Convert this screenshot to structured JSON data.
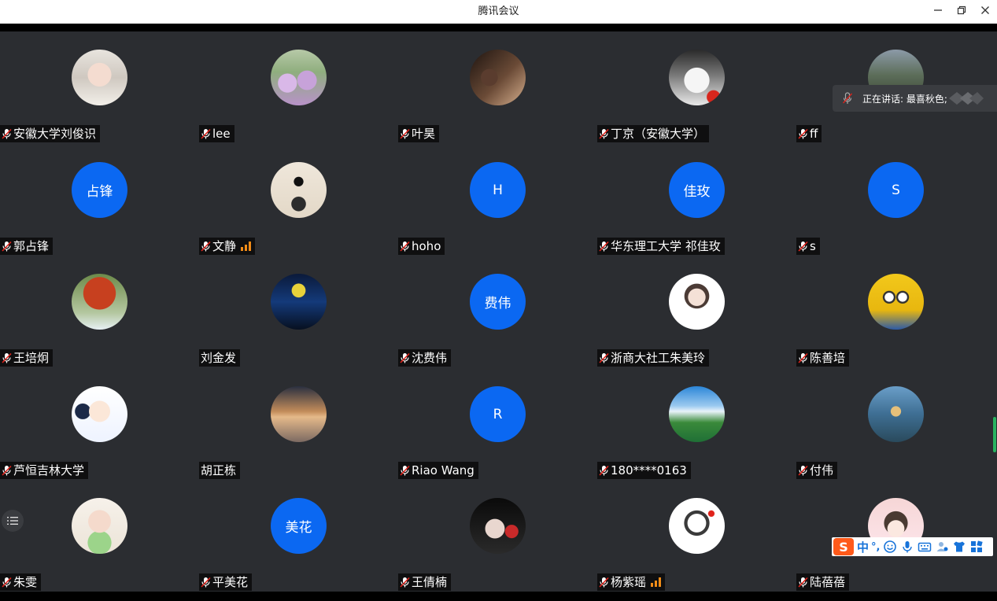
{
  "window": {
    "title": "腾讯会议",
    "minimize_icon": "minimize-icon",
    "maximize_icon": "restore-icon",
    "close_icon": "close-icon"
  },
  "speaking_indicator": {
    "label": "正在讲话: 最喜秋色;"
  },
  "ime_toolbar": {
    "mode": "中",
    "punct": "°,",
    "icons": [
      "smiley-icon",
      "microphone-icon",
      "keyboard-icon",
      "user-icon",
      "shirt-icon",
      "grid-icon"
    ]
  },
  "colors": {
    "avatar_blue": "#0b68f2",
    "tile_bg": "#2b2d31",
    "muted_mic_accent": "#e0231b",
    "signal_orange": "#f28c17",
    "scroll_green": "#27b35f"
  },
  "participants": [
    {
      "name": "安徽大学刘俊识",
      "muted": true,
      "avatar_type": "photo",
      "photo": "woman-with-mask",
      "signal": false
    },
    {
      "name": "lee",
      "muted": true,
      "avatar_type": "photo",
      "photo": "flowers",
      "signal": false
    },
    {
      "name": "叶昊",
      "muted": true,
      "avatar_type": "photo",
      "photo": "dim-room",
      "signal": false
    },
    {
      "name": "丁京（安徽大学）",
      "muted": true,
      "avatar_type": "photo",
      "photo": "anime-boy",
      "signal": false
    },
    {
      "name": "ff",
      "muted": true,
      "avatar_type": "photo",
      "photo": "mountain-valley",
      "signal": false
    },
    {
      "name": "郭占锋",
      "muted": true,
      "avatar_type": "initials",
      "initials": "占锋",
      "signal": false
    },
    {
      "name": "文静",
      "muted": true,
      "avatar_type": "photo",
      "photo": "doodle-girl",
      "signal": true
    },
    {
      "name": "hoho",
      "muted": true,
      "avatar_type": "initials",
      "initials": "H",
      "signal": false
    },
    {
      "name": "华东理工大学 祁佳玫",
      "muted": true,
      "avatar_type": "initials",
      "initials": "佳玫",
      "signal": false
    },
    {
      "name": "s",
      "muted": true,
      "avatar_type": "initials",
      "initials": "S",
      "signal": false
    },
    {
      "name": "王培炯",
      "muted": true,
      "avatar_type": "photo",
      "photo": "autumn-tree",
      "signal": false
    },
    {
      "name": "刘金发",
      "muted": false,
      "avatar_type": "photo",
      "photo": "night-lights",
      "signal": false
    },
    {
      "name": "沈费伟",
      "muted": true,
      "avatar_type": "initials",
      "initials": "费伟",
      "signal": false
    },
    {
      "name": "浙商大社工朱美玲",
      "muted": true,
      "avatar_type": "photo",
      "photo": "cartoon-girl",
      "signal": false
    },
    {
      "name": "陈善培",
      "muted": true,
      "avatar_type": "photo",
      "photo": "minion",
      "signal": false
    },
    {
      "name": "芦恒吉林大学",
      "muted": true,
      "avatar_type": "photo",
      "photo": "cartoon-monk",
      "signal": false
    },
    {
      "name": "胡正栋",
      "muted": false,
      "avatar_type": "photo",
      "photo": "beach-jump",
      "signal": false
    },
    {
      "name": "Riao Wang",
      "muted": true,
      "avatar_type": "initials",
      "initials": "R",
      "signal": false
    },
    {
      "name": "180****0163",
      "muted": true,
      "avatar_type": "photo",
      "photo": "lake-mountains",
      "signal": false
    },
    {
      "name": "付伟",
      "muted": true,
      "avatar_type": "photo",
      "photo": "yoga-lake",
      "signal": false
    },
    {
      "name": "朱雯",
      "muted": true,
      "avatar_type": "photo",
      "photo": "baby-girl",
      "signal": false
    },
    {
      "name": "平美花",
      "muted": true,
      "avatar_type": "initials",
      "initials": "美花",
      "signal": false
    },
    {
      "name": "王倩楠",
      "muted": true,
      "avatar_type": "photo",
      "photo": "red-hair-girl",
      "signal": false
    },
    {
      "name": "杨紫瑶",
      "muted": true,
      "avatar_type": "photo",
      "photo": "sketch-girl",
      "signal": true
    },
    {
      "name": "陆蓓蓓",
      "muted": true,
      "avatar_type": "photo",
      "photo": "pink-girl",
      "signal": false
    }
  ]
}
